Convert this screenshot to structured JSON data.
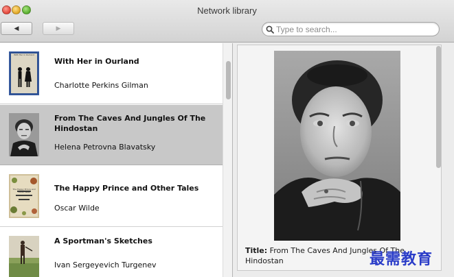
{
  "window": {
    "title": "Network library"
  },
  "toolbar": {
    "back_icon": "◀",
    "forward_icon": "▶"
  },
  "search": {
    "placeholder": "Type to search..."
  },
  "books": [
    {
      "title": "With Her in Ourland",
      "author": "Charlotte Perkins Gilman",
      "cover_text": "With Her in Ourland",
      "selected": false
    },
    {
      "title": "From The Caves And Jungles Of The Hindostan",
      "author": "Helena Petrovna Blavatsky",
      "selected": true
    },
    {
      "title": "The Happy Prince and Other Tales",
      "author": "Oscar Wilde",
      "cover_text": "The Happy Prince and Other Tales",
      "selected": false
    },
    {
      "title": "A Sportman's Sketches",
      "author": "Ivan Sergeyevich Turgenev",
      "selected": false
    }
  ],
  "detail": {
    "title_label": "Title:",
    "title_value": "From The Caves And Jungles Of The Hindostan"
  },
  "watermark": "最需教育",
  "colors": {
    "selected_row": "#c8c8c8",
    "watermark": "#2a3cc8"
  }
}
